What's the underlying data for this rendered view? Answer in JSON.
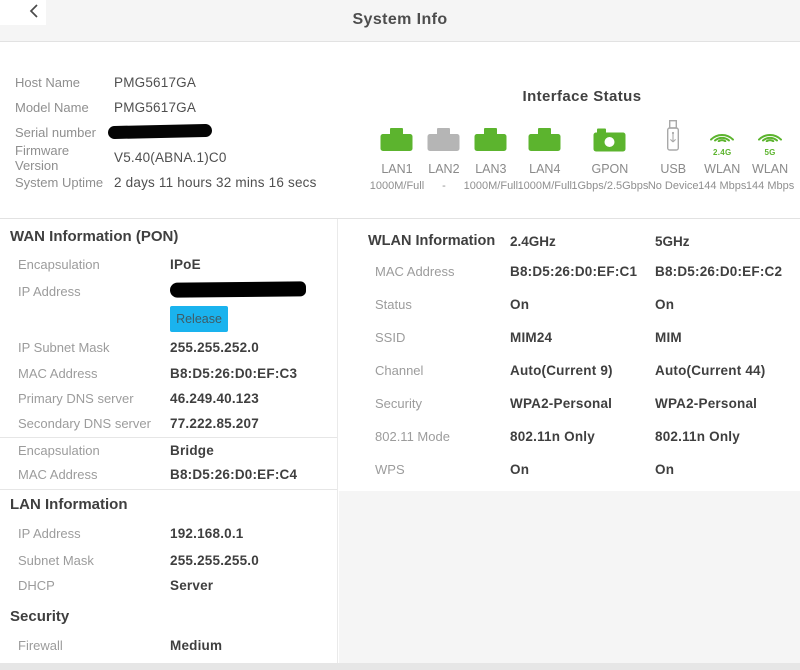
{
  "header": {
    "title": "System Info"
  },
  "device_info": {
    "rows": [
      {
        "label": "Host Name",
        "value": "PMG5617GA"
      },
      {
        "label": "Model Name",
        "value": "PMG5617GA"
      },
      {
        "label": "Serial number",
        "value": "",
        "redacted": true
      },
      {
        "label": "Firmware Version",
        "value": "V5.40(ABNA.1)C0"
      },
      {
        "label": "System Uptime",
        "value": "2 days 11 hours 32 mins 16 secs"
      }
    ]
  },
  "interface_status": {
    "title": "Interface Status",
    "items": [
      {
        "name": "LAN1",
        "status": "1000M/Full",
        "icon": "ethernet-port-icon",
        "active": true
      },
      {
        "name": "LAN2",
        "status": "-",
        "icon": "ethernet-port-icon",
        "active": false
      },
      {
        "name": "LAN3",
        "status": "1000M/Full",
        "icon": "ethernet-port-icon",
        "active": true
      },
      {
        "name": "LAN4",
        "status": "1000M/Full",
        "icon": "ethernet-port-icon",
        "active": true
      },
      {
        "name": "GPON",
        "status": "1Gbps/2.5Gbps",
        "icon": "gpon-icon",
        "active": true
      },
      {
        "name": "USB",
        "status": "No Device",
        "icon": "usb-icon",
        "active": false
      },
      {
        "name": "WLAN",
        "status": "144 Mbps",
        "icon": "wifi-icon",
        "band": "2.4G",
        "active": true
      },
      {
        "name": "WLAN",
        "status": "144 Mbps",
        "icon": "wifi-icon",
        "band": "5G",
        "active": true
      }
    ]
  },
  "wan": {
    "title": "WAN Information (PON)",
    "release_label": "Release",
    "rows": [
      {
        "label": "Encapsulation",
        "value": "IPoE"
      },
      {
        "label": "IP Address",
        "value": "",
        "redacted": true,
        "button": "Release"
      },
      {
        "label": "IP Subnet Mask",
        "value": "255.255.252.0"
      },
      {
        "label": "MAC Address",
        "value": "B8:D5:26:D0:EF:C3"
      },
      {
        "label": "Primary DNS server",
        "value": "46.249.40.123"
      },
      {
        "label": "Secondary DNS server",
        "value": "77.222.85.207",
        "divider_after": true
      },
      {
        "label": "Encapsulation",
        "value": "Bridge"
      },
      {
        "label": "MAC Address",
        "value": "B8:D5:26:D0:EF:C4",
        "divider_after": true
      }
    ]
  },
  "lan": {
    "title": "LAN Information",
    "rows": [
      {
        "label": "IP Address",
        "value": "192.168.0.1"
      },
      {
        "label": "Subnet Mask",
        "value": "255.255.255.0"
      },
      {
        "label": "DHCP",
        "value": "Server"
      }
    ]
  },
  "security": {
    "title": "Security",
    "rows": [
      {
        "label": "Firewall",
        "value": "Medium"
      }
    ]
  },
  "wlan": {
    "title": "WLAN Information",
    "columns": [
      "2.4GHz",
      "5GHz"
    ],
    "rows": [
      {
        "label": "MAC Address",
        "values": [
          "B8:D5:26:D0:EF:C1",
          "B8:D5:26:D0:EF:C2"
        ]
      },
      {
        "label": "Status",
        "values": [
          "On",
          "On"
        ]
      },
      {
        "label": "SSID",
        "values": [
          "MIM24",
          "MIM"
        ]
      },
      {
        "label": "Channel",
        "values": [
          "Auto(Current 9)",
          "Auto(Current 44)"
        ]
      },
      {
        "label": "Security",
        "values": [
          "WPA2-Personal",
          "WPA2-Personal"
        ]
      },
      {
        "label": "802.11 Mode",
        "values": [
          "802.11n Only",
          "802.11n Only"
        ]
      },
      {
        "label": "WPS",
        "values": [
          "On",
          "On"
        ]
      }
    ]
  },
  "colors": {
    "accent_green": "#5cb42e",
    "inactive_gray": "#b5b5b5",
    "usb_gray": "#a9a9a9",
    "release_button_bg": "#1ab3ee",
    "redaction": "#000000"
  }
}
